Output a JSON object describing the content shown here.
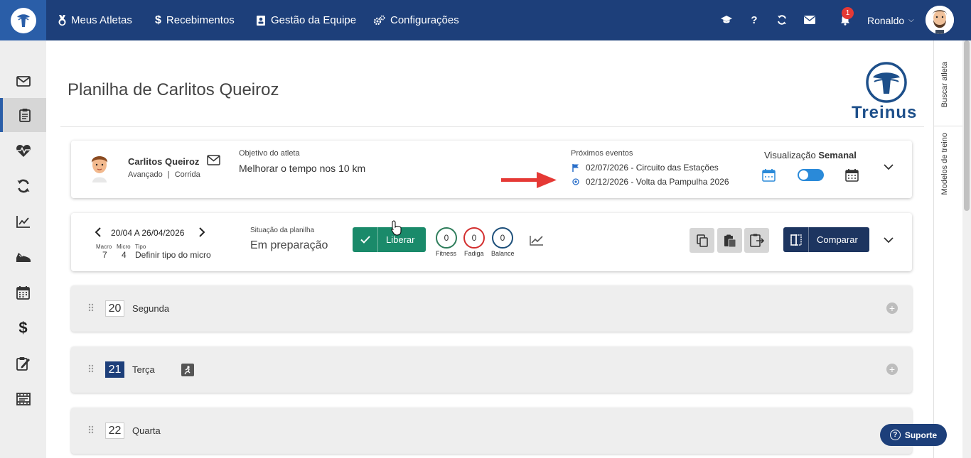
{
  "nav": {
    "athletes": "Meus Atletas",
    "payments": "Recebimentos",
    "team": "Gestão da Equipe",
    "settings": "Configurações",
    "notifications_count": "1",
    "user_name": "Ronaldo"
  },
  "rail": {
    "search_athlete": "Buscar atleta",
    "workout_models": "Modelos de treino"
  },
  "page": {
    "title": "Planilha de Carlitos Queiroz",
    "brand": "Treinus"
  },
  "athlete": {
    "name": "Carlitos Queiroz",
    "level": "Avançado",
    "sport": "Corrida",
    "separator": "|",
    "objective_label": "Objetivo do atleta",
    "objective": "Melhorar o tempo nos 10 km",
    "events_label": "Próximos eventos",
    "events": [
      {
        "text": "02/07/2026 - Circuito das Estações"
      },
      {
        "text": "02/12/2026 - Volta da Pampulha 2026"
      }
    ],
    "view_label": "Visualização",
    "view_mode": "Semanal"
  },
  "week": {
    "range": "20/04 A 26/04/2026",
    "macro_label": "Macro",
    "micro_label": "Micro",
    "type_label": "Tipo",
    "macro": "7",
    "micro": "4",
    "type": "Definir tipo do micro",
    "status_label": "Situação da planilha",
    "status": "Em preparação",
    "release_label": "Liberar",
    "fitness_value": "0",
    "fitness_label": "Fitness",
    "fatigue_value": "0",
    "fatigue_label": "Fadiga",
    "balance_value": "0",
    "balance_label": "Balance",
    "compare_label": "Comparar"
  },
  "days": [
    {
      "num": "20",
      "name": "Segunda"
    },
    {
      "num": "21",
      "name": "Terça"
    },
    {
      "num": "22",
      "name": "Quarta"
    }
  ],
  "support": "Suporte",
  "colors": {
    "navbar": "#1d3f7a",
    "accent": "#2a5ea8",
    "release_green": "#1a8a6a",
    "fitness": "#2e7d5b",
    "fatigue": "#d32f2f",
    "balance": "#1d4f7a"
  }
}
